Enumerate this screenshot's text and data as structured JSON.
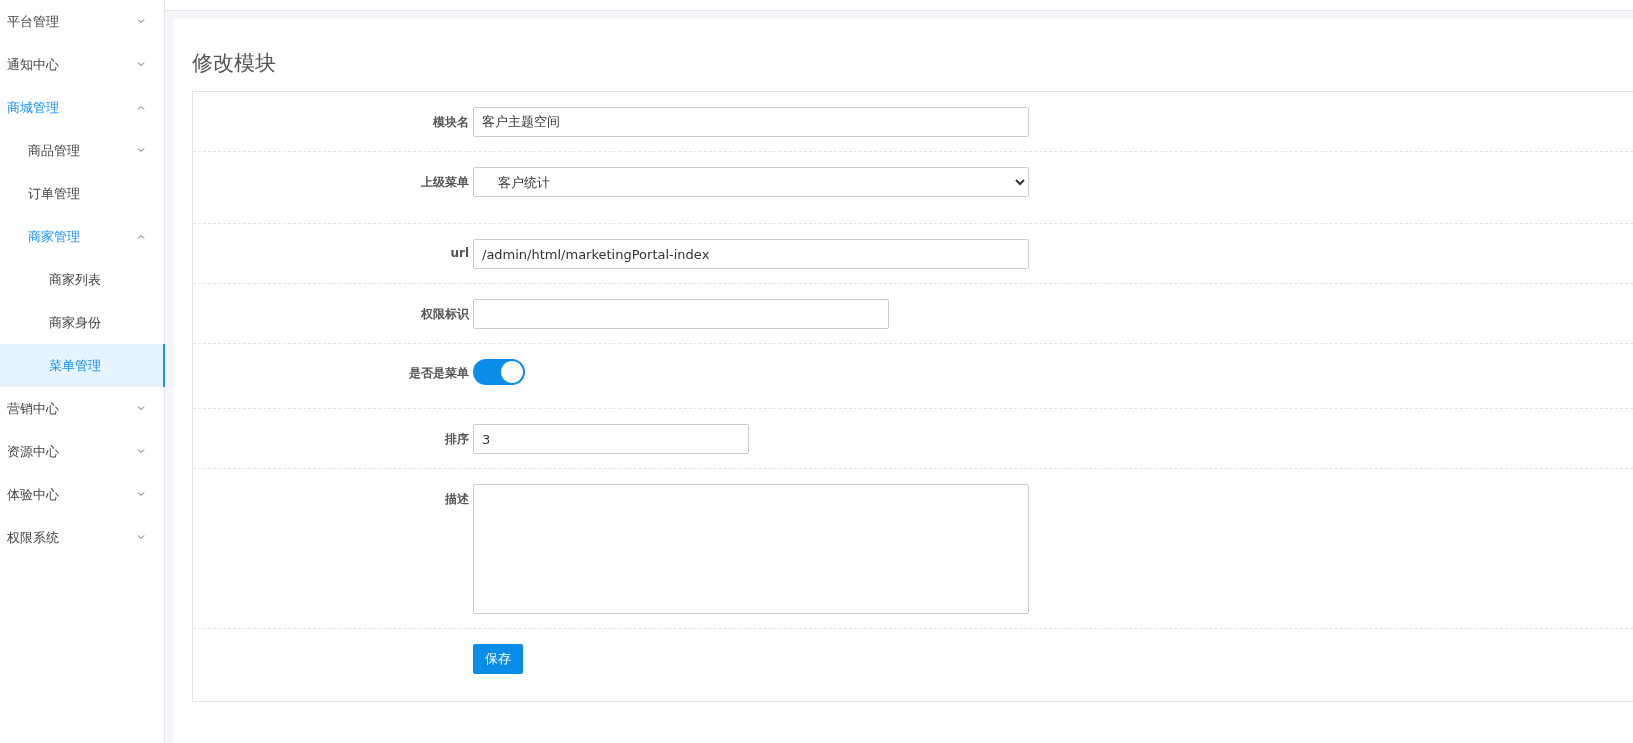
{
  "sidebar": {
    "items": [
      {
        "label": "平台管理",
        "kind": "group",
        "expanded": false,
        "selected": false
      },
      {
        "label": "通知中心",
        "kind": "group",
        "expanded": false,
        "selected": false
      },
      {
        "label": "商城管理",
        "kind": "group",
        "expanded": true,
        "selected": false,
        "children": [
          {
            "label": "商品管理",
            "kind": "group",
            "expanded": false,
            "selected": false
          },
          {
            "label": "订单管理",
            "kind": "link",
            "selected": false
          },
          {
            "label": "商家管理",
            "kind": "group",
            "expanded": true,
            "selected": false,
            "children": [
              {
                "label": "商家列表",
                "kind": "link",
                "selected": false
              },
              {
                "label": "商家身份",
                "kind": "link",
                "selected": false
              },
              {
                "label": "菜单管理",
                "kind": "link",
                "selected": true
              }
            ]
          }
        ]
      },
      {
        "label": "营销中心",
        "kind": "group",
        "expanded": false,
        "selected": false
      },
      {
        "label": "资源中心",
        "kind": "group",
        "expanded": false,
        "selected": false
      },
      {
        "label": "体验中心",
        "kind": "group",
        "expanded": false,
        "selected": false
      },
      {
        "label": "权限系统",
        "kind": "group",
        "expanded": false,
        "selected": false
      }
    ]
  },
  "page": {
    "title": "修改模块"
  },
  "form": {
    "fields": [
      {
        "label": "模块名",
        "kind": "text",
        "value": "客户主题空间"
      },
      {
        "label": "上级菜单",
        "kind": "select",
        "value": "客户统计"
      },
      {
        "label": "url",
        "kind": "text",
        "value": "/admin/html/marketingPortal-index"
      },
      {
        "label": "权限标识",
        "kind": "text"
      },
      {
        "label": "是否是菜单",
        "kind": "switch",
        "on": true
      },
      {
        "label": "排序",
        "kind": "text",
        "value": "3"
      },
      {
        "label": "描述",
        "kind": "textarea"
      }
    ],
    "submit": "保存"
  }
}
